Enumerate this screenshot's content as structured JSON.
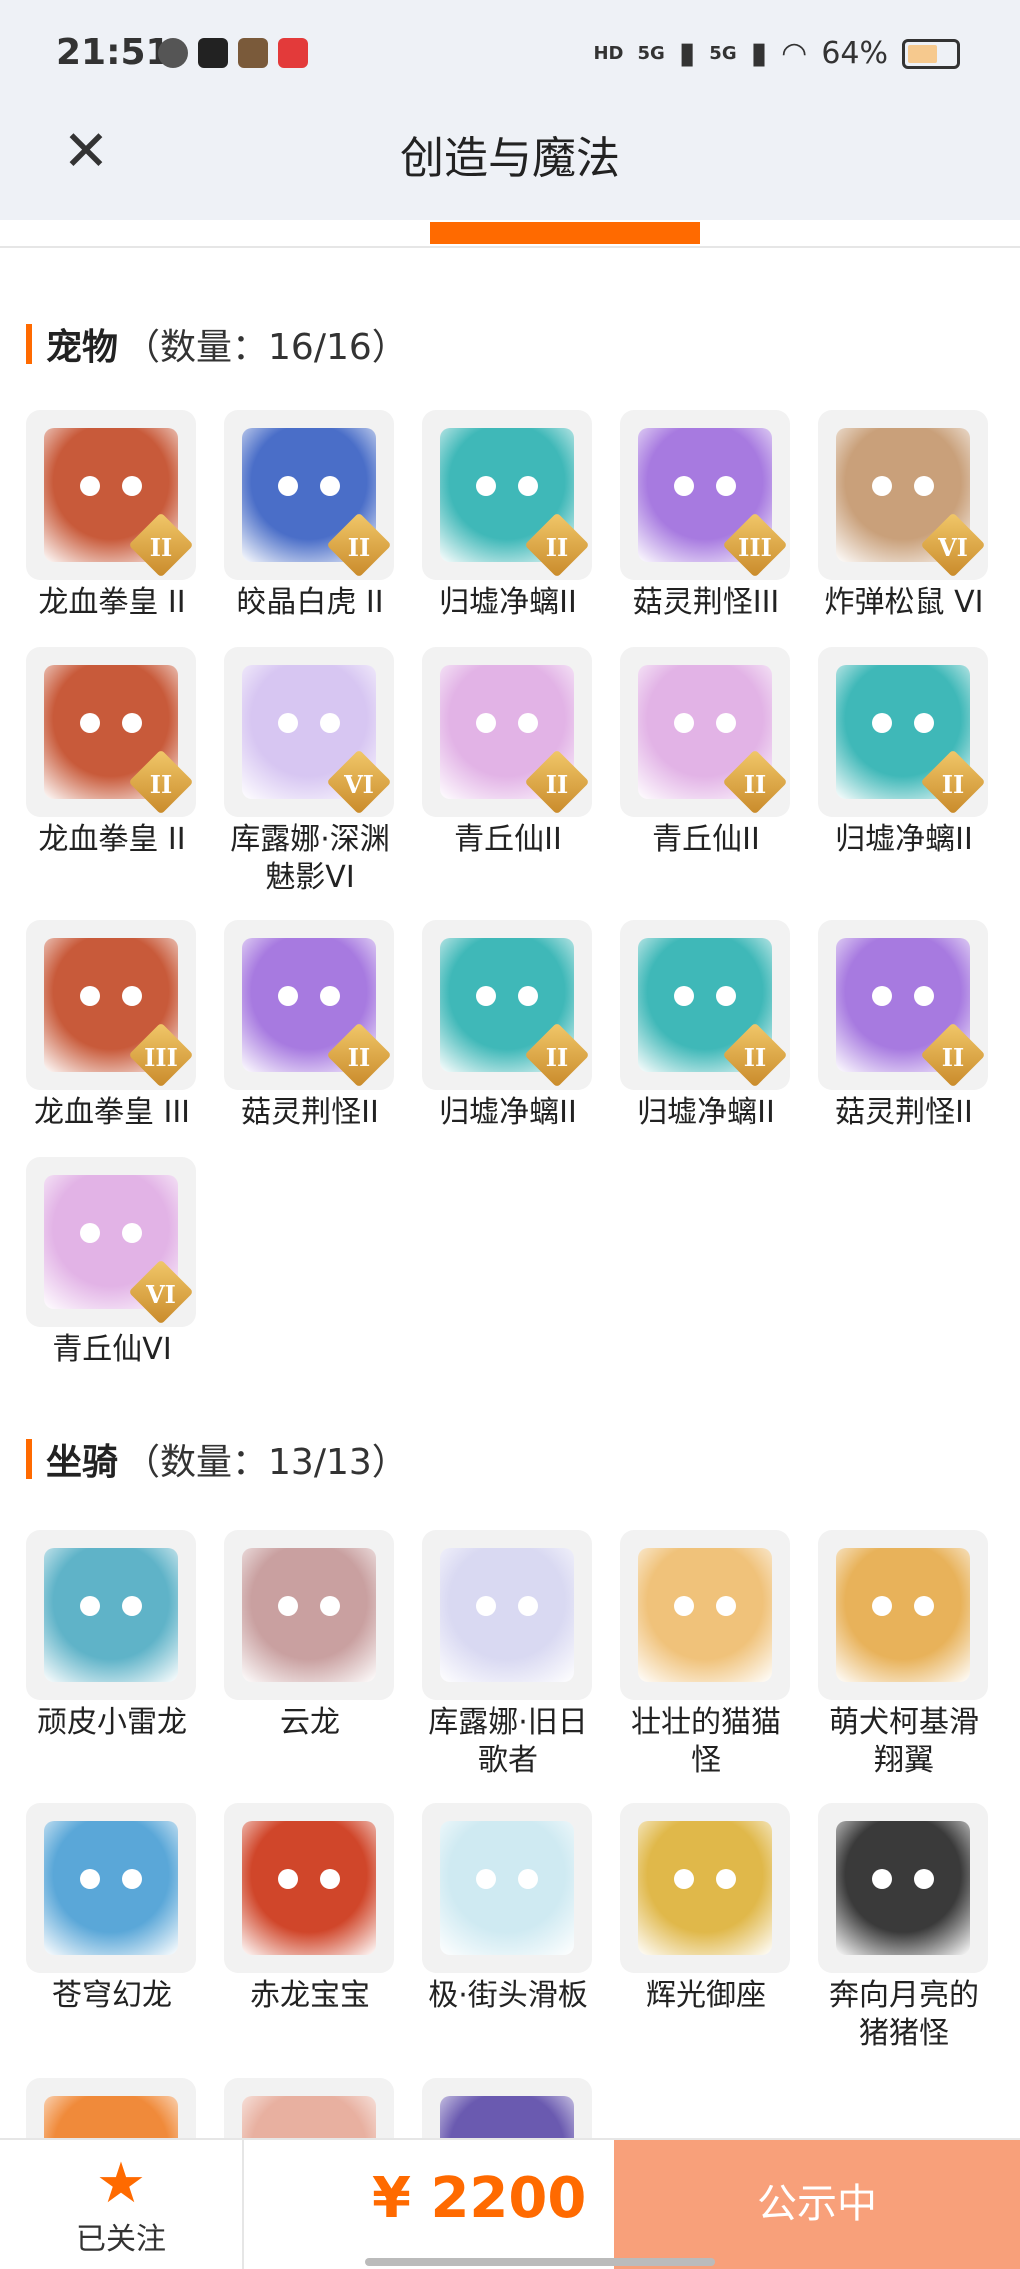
{
  "status_bar": {
    "time": "21:51",
    "battery": "64%",
    "battery_level": 0.64,
    "network_1": "5G",
    "network_2": "5G",
    "hd_badge": "HD"
  },
  "header": {
    "title": "创造与魔法"
  },
  "pets": {
    "section_name": "宠物",
    "count_text": "（数量：16/16）",
    "items": [
      {
        "label": "龙血拳皇 II",
        "badge": "II",
        "color": "#c85a3a"
      },
      {
        "label": "皎晶白虎 II",
        "badge": "II",
        "color": "#4a6ec8"
      },
      {
        "label": "归墟净螭II",
        "badge": "II",
        "color": "#3fb8b8"
      },
      {
        "label": "菇灵荆怪III",
        "badge": "III",
        "color": "#a77ae0"
      },
      {
        "label": "炸弹松鼠 VI",
        "badge": "VI",
        "color": "#c9a07a"
      },
      {
        "label": "龙血拳皇 II",
        "badge": "II",
        "color": "#c85a3a"
      },
      {
        "label": "库露娜·深渊魅影VI",
        "badge": "VI",
        "color": "#d7c6f2"
      },
      {
        "label": "青丘仙II",
        "badge": "II",
        "color": "#e2b3e6"
      },
      {
        "label": "青丘仙II",
        "badge": "II",
        "color": "#e2b3e6"
      },
      {
        "label": "归墟净螭II",
        "badge": "II",
        "color": "#3fb8b8"
      },
      {
        "label": "龙血拳皇 III",
        "badge": "III",
        "color": "#c85a3a"
      },
      {
        "label": "菇灵荆怪II",
        "badge": "II",
        "color": "#a77ae0"
      },
      {
        "label": "归墟净螭II",
        "badge": "II",
        "color": "#3fb8b8"
      },
      {
        "label": "归墟净螭II",
        "badge": "II",
        "color": "#3fb8b8"
      },
      {
        "label": "菇灵荆怪II",
        "badge": "II",
        "color": "#a77ae0"
      },
      {
        "label": "青丘仙VI",
        "badge": "VI",
        "color": "#e2b3e6"
      }
    ]
  },
  "mounts": {
    "section_name": "坐骑",
    "count_text": "（数量：13/13）",
    "items": [
      {
        "label": "顽皮小雷龙",
        "color": "#5fb3c8"
      },
      {
        "label": "云龙",
        "color": "#c9a0a0"
      },
      {
        "label": "库露娜·旧日歌者",
        "color": "#d9d9f2"
      },
      {
        "label": "壮壮的猫猫怪",
        "color": "#f0c27a"
      },
      {
        "label": "萌犬柯基滑翔翼",
        "color": "#e8b25a"
      },
      {
        "label": "苍穹幻龙",
        "color": "#5aa7d8"
      },
      {
        "label": "赤龙宝宝",
        "color": "#d0462a"
      },
      {
        "label": "极·街头滑板",
        "color": "#cfeaf2"
      },
      {
        "label": "辉光御座",
        "color": "#e0b84a"
      },
      {
        "label": "奔向月亮的猪猪怪",
        "color": "#3a3a3a"
      },
      {
        "label": "",
        "color": "#f08a3a"
      },
      {
        "label": "",
        "color": "#e8b0a0"
      },
      {
        "label": "",
        "color": "#6a5ab0"
      }
    ]
  },
  "bottom": {
    "follow_label": "已关注",
    "price": "¥ 2200",
    "cta_label": "公示中"
  }
}
